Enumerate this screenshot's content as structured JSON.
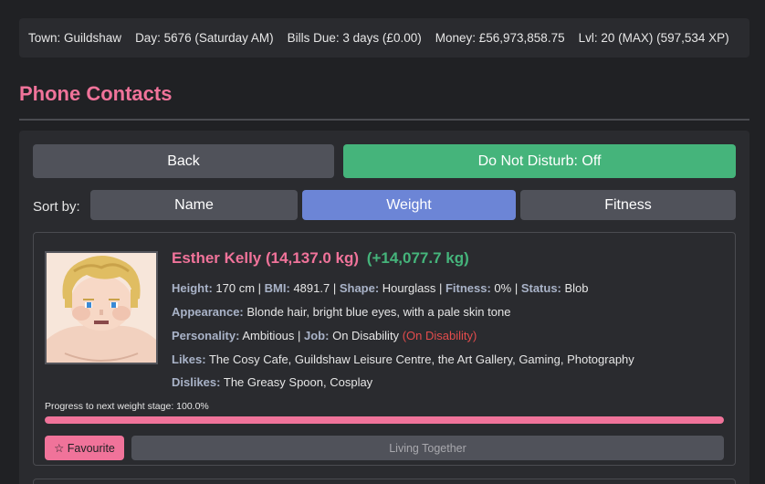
{
  "status": {
    "town": "Town: Guildshaw",
    "day": "Day: 5676 (Saturday AM)",
    "bills": "Bills Due: 3 days (£0.00)",
    "money": "Money: £56,973,858.75",
    "level": "Lvl: 20 (MAX) (597,534 XP)"
  },
  "page": {
    "title": "Phone Contacts"
  },
  "actions": {
    "back": "Back",
    "dnd": "Do Not Disturb: Off"
  },
  "sort": {
    "label": "Sort by:",
    "options": [
      "Name",
      "Weight",
      "Fitness"
    ],
    "selected": "Weight"
  },
  "contact": {
    "name": "Esther Kelly (14,137.0 kg)",
    "gain": "(+14,077.7 kg)",
    "height_label": "Height:",
    "height": "170 cm",
    "bmi_label": "BMI:",
    "bmi": "4891.7",
    "shape_label": "Shape:",
    "shape": "Hourglass",
    "fitness_label": "Fitness:",
    "fitness": "0%",
    "status_label": "Status:",
    "status": "Blob",
    "appearance_label": "Appearance:",
    "appearance": "Blonde hair, bright blue eyes, with a pale skin tone",
    "personality_label": "Personality:",
    "personality": "Ambitious",
    "job_label": "Job:",
    "job": "On Disability",
    "job_note": "(On Disability)",
    "likes_label": "Likes:",
    "likes": "The Cosy Cafe, Guildshaw Leisure Centre, the Art Gallery, Gaming, Photography",
    "dislikes_label": "Dislikes:",
    "dislikes": "The Greasy Spoon, Cosplay",
    "progress_label": "Progress to next weight stage: 100.0%",
    "progress": 1.0,
    "favourite": "☆ Favourite",
    "living": "Living Together"
  },
  "colors": {
    "accent_pink": "#f0739a",
    "accent_green": "#45b47b",
    "accent_blue": "#6c85d6",
    "warning_red": "#e34c4c"
  }
}
